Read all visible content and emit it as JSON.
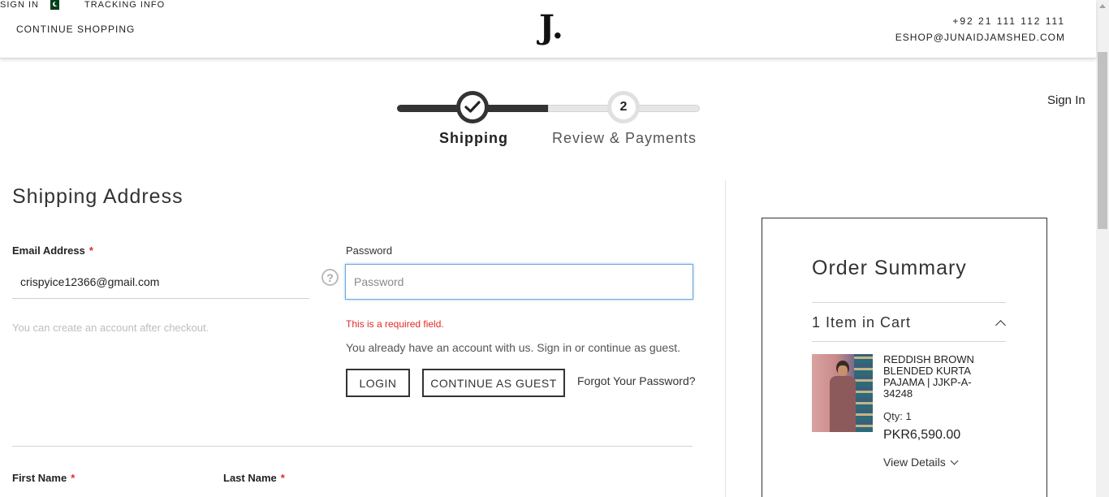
{
  "header": {
    "sign_in": "SIGN IN",
    "tracking_info": "TRACKING INFO",
    "continue_shopping": "CONTINUE SHOPPING",
    "logo": "J.",
    "phone": "+92 21 111 112 111",
    "email": "ESHOP@JUNAIDJAMSHED.COM",
    "flag_icon": "pakistan-flag-icon"
  },
  "progress": {
    "steps": [
      {
        "label": "Shipping",
        "marker": "✓",
        "state": "complete"
      },
      {
        "label": "Review & Payments",
        "marker": "2",
        "state": "pending"
      }
    ]
  },
  "top_sign_in": "Sign In",
  "shipping": {
    "title": "Shipping Address",
    "email_label": "Email Address",
    "required_mark": "*",
    "email_value": "crispyice12366@gmail.com",
    "help_glyph": "?",
    "email_note": "You can create an account after checkout.",
    "password_label": "Password",
    "password_placeholder": "Password",
    "password_error": "This is a required field.",
    "password_note": "You already have an account with us. Sign in or continue as guest.",
    "login_button": "LOGIN",
    "guest_button": "CONTINUE AS GUEST",
    "forgot_link": "Forgot Your Password?",
    "first_name_label": "First Name",
    "last_name_label": "Last Name"
  },
  "summary": {
    "title": "Order Summary",
    "cart_count": "1 Item in Cart",
    "item": {
      "name": "REDDISH BROWN BLENDED KURTA PAJAMA | JJKP-A-34248",
      "qty": "Qty: 1",
      "price": "PKR6,590.00"
    },
    "view_details": "View Details"
  },
  "colors": {
    "accent_dark": "#333333",
    "error": "#e02b27",
    "focus_border": "#68a8e0",
    "flag_green": "#01411c"
  }
}
